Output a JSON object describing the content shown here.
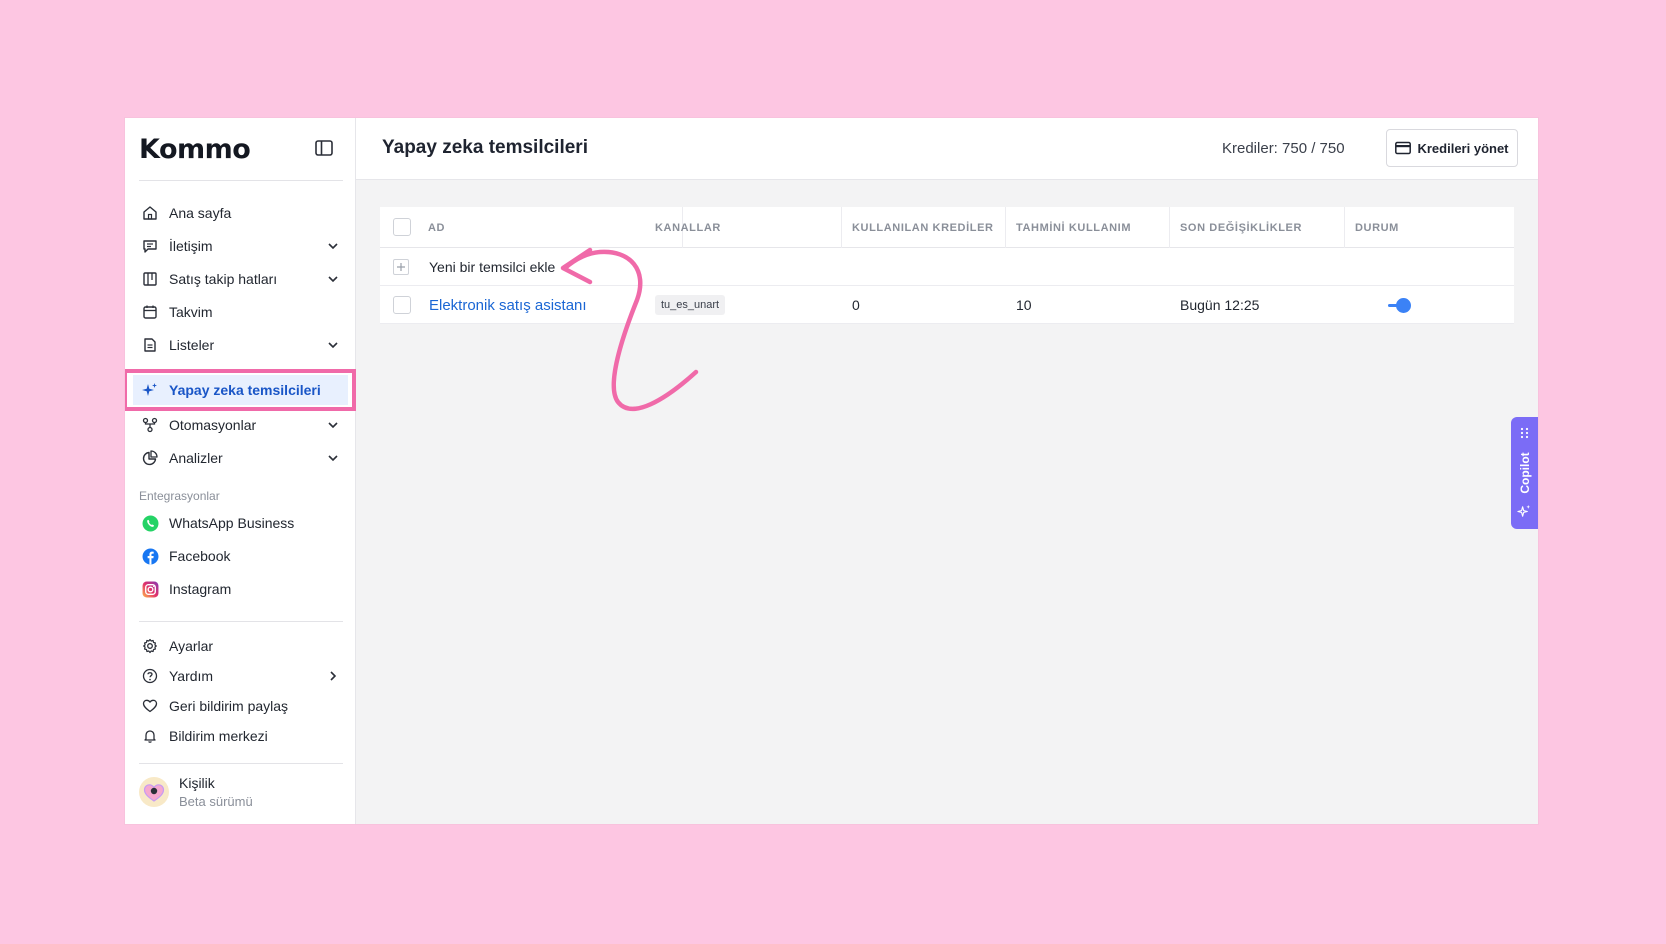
{
  "brand": {
    "logo_text": "Kommo"
  },
  "sidebar": {
    "items": [
      {
        "label": "Ana sayfa",
        "icon": "home-icon"
      },
      {
        "label": "İletişim",
        "icon": "chat-icon"
      },
      {
        "label": "Satış takip hatları",
        "icon": "pipeline-icon"
      },
      {
        "label": "Takvim",
        "icon": "calendar-icon"
      },
      {
        "label": "Listeler",
        "icon": "document-icon"
      },
      {
        "label": "Yapay zeka temsilcileri",
        "icon": "sparkle-icon"
      },
      {
        "label": "Otomasyonlar",
        "icon": "automation-icon"
      },
      {
        "label": "Analizler",
        "icon": "pie-chart-icon"
      }
    ],
    "integrations_label": "Entegrasyonlar",
    "integrations": [
      {
        "label": "WhatsApp Business",
        "icon": "whatsapp-icon"
      },
      {
        "label": "Facebook",
        "icon": "facebook-icon"
      },
      {
        "label": "Instagram",
        "icon": "instagram-icon"
      }
    ],
    "bottom": [
      {
        "label": "Ayarlar",
        "icon": "gear-icon"
      },
      {
        "label": "Yardım",
        "icon": "help-icon"
      },
      {
        "label": "Geri bildirim paylaş",
        "icon": "heart-icon"
      },
      {
        "label": "Bildirim merkezi",
        "icon": "bell-icon"
      }
    ],
    "user": {
      "name": "Kişilik",
      "subtitle": "Beta sürümü"
    }
  },
  "header": {
    "title": "Yapay zeka temsilcileri",
    "credits": "Krediler: 750 / 750",
    "manage_button": "Kredileri yönet"
  },
  "table": {
    "columns": [
      "AD",
      "KANALLAR",
      "KULLANILAN KREDİLER",
      "TAHMİNİ KULLANIM",
      "SON DEĞİŞİKLİKLER",
      "DURUM"
    ],
    "add_row_label": "Yeni bir temsilci ekle",
    "rows": [
      {
        "name": "Elektronik satış asistanı",
        "channel": "tu_es_unart",
        "used_credits": "0",
        "estimated_usage": "10",
        "last_changed": "Bugün 12:25",
        "active": true
      }
    ]
  },
  "copilot": {
    "label": "Copilot"
  },
  "colors": {
    "accent": "#1a66d4",
    "highlight": "#f06aa9",
    "copilot": "#7b6cf6",
    "background": "#fdc6e2"
  }
}
